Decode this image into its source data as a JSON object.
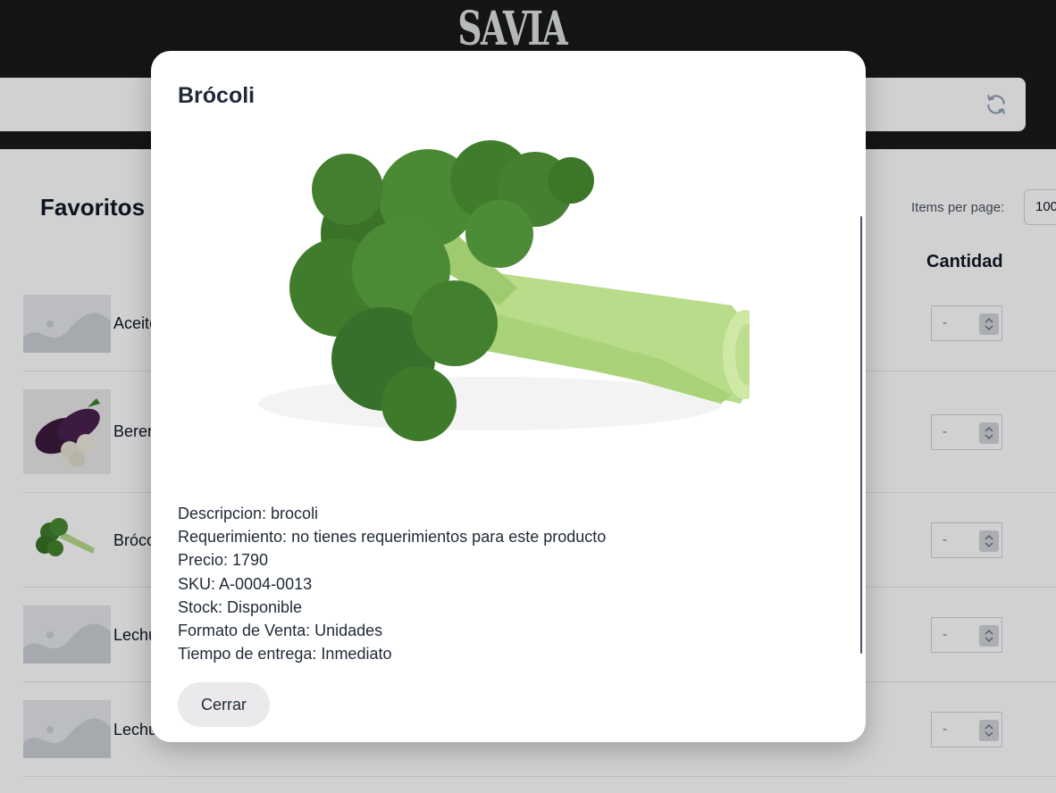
{
  "app": {
    "brand": "SAVIA"
  },
  "page": {
    "title": "Favoritos",
    "items_per_page_label": "Items per page:",
    "items_per_page_value": "100",
    "column_quantity": "Cantidad",
    "rows": [
      {
        "name": "Aceite",
        "thumb": "placeholder-icon",
        "qty": "-"
      },
      {
        "name": "Berenjena",
        "thumb": "eggplant-image",
        "qty": "-"
      },
      {
        "name": "Brócoli",
        "thumb": "broccoli-image",
        "qty": "-"
      },
      {
        "name": "Lechuga",
        "thumb": "placeholder-icon",
        "qty": "-"
      },
      {
        "name": "Lechuga",
        "thumb": "placeholder-icon",
        "qty": "-"
      }
    ]
  },
  "modal": {
    "title": "Brócoli",
    "image": "broccoli-image",
    "details": [
      "Descripcion: brocoli",
      "Requerimiento: no tienes requerimientos para este producto",
      "Precio: 1790",
      "SKU: A-0004-0013",
      "Stock: Disponible",
      "Formato de Venta: Unidades",
      "Tiempo de entrega: Inmediato"
    ],
    "close_label": "Cerrar"
  },
  "colors": {
    "header_bg": "#1a1a1a",
    "broccoli_green": "#3f7d2c",
    "stem_green": "#b8dc8a",
    "button_bg": "#ece9ec"
  }
}
